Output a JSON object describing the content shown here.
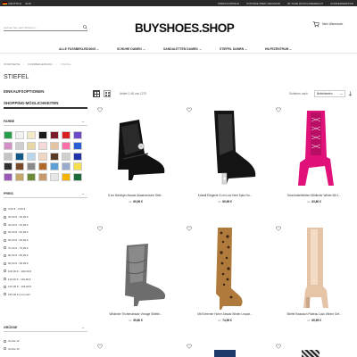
{
  "topbar": {
    "lang": "DEUTSCH",
    "currency": "EUR",
    "links": [
      "PREISVORTEILE",
      "KOSTENLOSER VERSAND",
      "30-TAGE RÜCKGABERECHT",
      "KUNDENSERVICE"
    ]
  },
  "header": {
    "search_placeholder": "Suchen Sie nach Schuhen ...",
    "logo": "BUYSHOES.SHOP",
    "cart_label": "Mein Warenkorb"
  },
  "nav": [
    {
      "label": "ALLE FUSSBEKLEIDUNG",
      "chevron": true
    },
    {
      "label": "SCHUHE DAMEN",
      "chevron": true
    },
    {
      "label": "SANDALETTEN DAMEN",
      "chevron": true
    },
    {
      "label": "STIEFEL DAMEN",
      "chevron": true
    },
    {
      "label": "HILFEZENTRUM",
      "chevron": true
    }
  ],
  "breadcrumb": [
    "STARTSEITE",
    "FUSSBEKLEIDUNG",
    "STIEFEL"
  ],
  "page_title": "STIEFEL",
  "sidebar": {
    "options_title": "EINKAUFSOPTIONEN",
    "shopping_title": "SHOPPING-MÖGLICHKEITEN",
    "color_title": "FARBE",
    "price_title": "PREIS",
    "size_title": "GRÖSSE",
    "colors": [
      "#2a9d4a",
      "#f2f2f2",
      "#f3e9c9",
      "#1a1a1a",
      "#7a1c2a",
      "#d82020",
      "#6b4bc8",
      "#d48fc7",
      "#cfcfcf",
      "#e9d8a6",
      "#f5d9d9",
      "#e6c3a0",
      "#ff6fa8",
      "#2a5fd6",
      "#c4c4c4",
      "#0f5a8a",
      "#b9d6ea",
      "#f0d8c0",
      "#5a3a22",
      "#d0d0d0",
      "#2233aa",
      "#303030",
      "#7a4a2a",
      "#8a8a8a",
      "#b36a2a",
      "#5aa0d8",
      "#9ac",
      "#f4e04a",
      "#9b59b6",
      "#c8a86a",
      "#6a8a3a",
      "#c79b6a",
      "#e6e6e6",
      "#f4b400",
      "#1b6b3a"
    ],
    "prices": [
      "0,00 € - 9,99 €",
      "30,00 € - 39,99 €",
      "40,00 € - 49,99 €",
      "50,00 € - 59,99 €",
      "60,00 € - 69,99 €",
      "70,00 € - 79,99 €",
      "80,00 € - 89,99 €",
      "90,00 € - 99,99 €",
      "100,00 € - 109,99 €",
      "110,00 € - 119,99 €",
      "120,00 € - 129,99 €",
      "150,00 € und mehr"
    ],
    "sizes": [
      "Größe 32",
      "Größe 33"
    ]
  },
  "toolbar": {
    "count": "Artikel 1-60 von 1270",
    "sort_label": "Sortieren nach",
    "sort_value": "Beliebtesten"
  },
  "products": [
    {
      "name": "5 cm Niedriger Absatz Absatzschuhe Stief...",
      "price_prefix": "Ab",
      "price": "69,99 €"
    },
    {
      "name": "Kristall Elegante 5 cm Low Heel Spitz No...",
      "price_prefix": "Ab",
      "price": "69,99 €"
    },
    {
      "name": "Schnürstiefeletten Wildleder Winter Mit 1...",
      "price_prefix": "Ab",
      "price": "63,80 €"
    },
    {
      "name": "Wildleder Trichterabsatz Vintage Stilette...",
      "price_prefix": "Ab",
      "price": "59,80 €"
    },
    {
      "name": "Mit Extremer Hoher Absatz Winter Leopar...",
      "price_prefix": "Ab",
      "price": "74,99 €"
    },
    {
      "name": "Stiefel Klassisch Plateau Lack Winter Gef...",
      "price_prefix": "Ab",
      "price": "69,99 €"
    }
  ]
}
